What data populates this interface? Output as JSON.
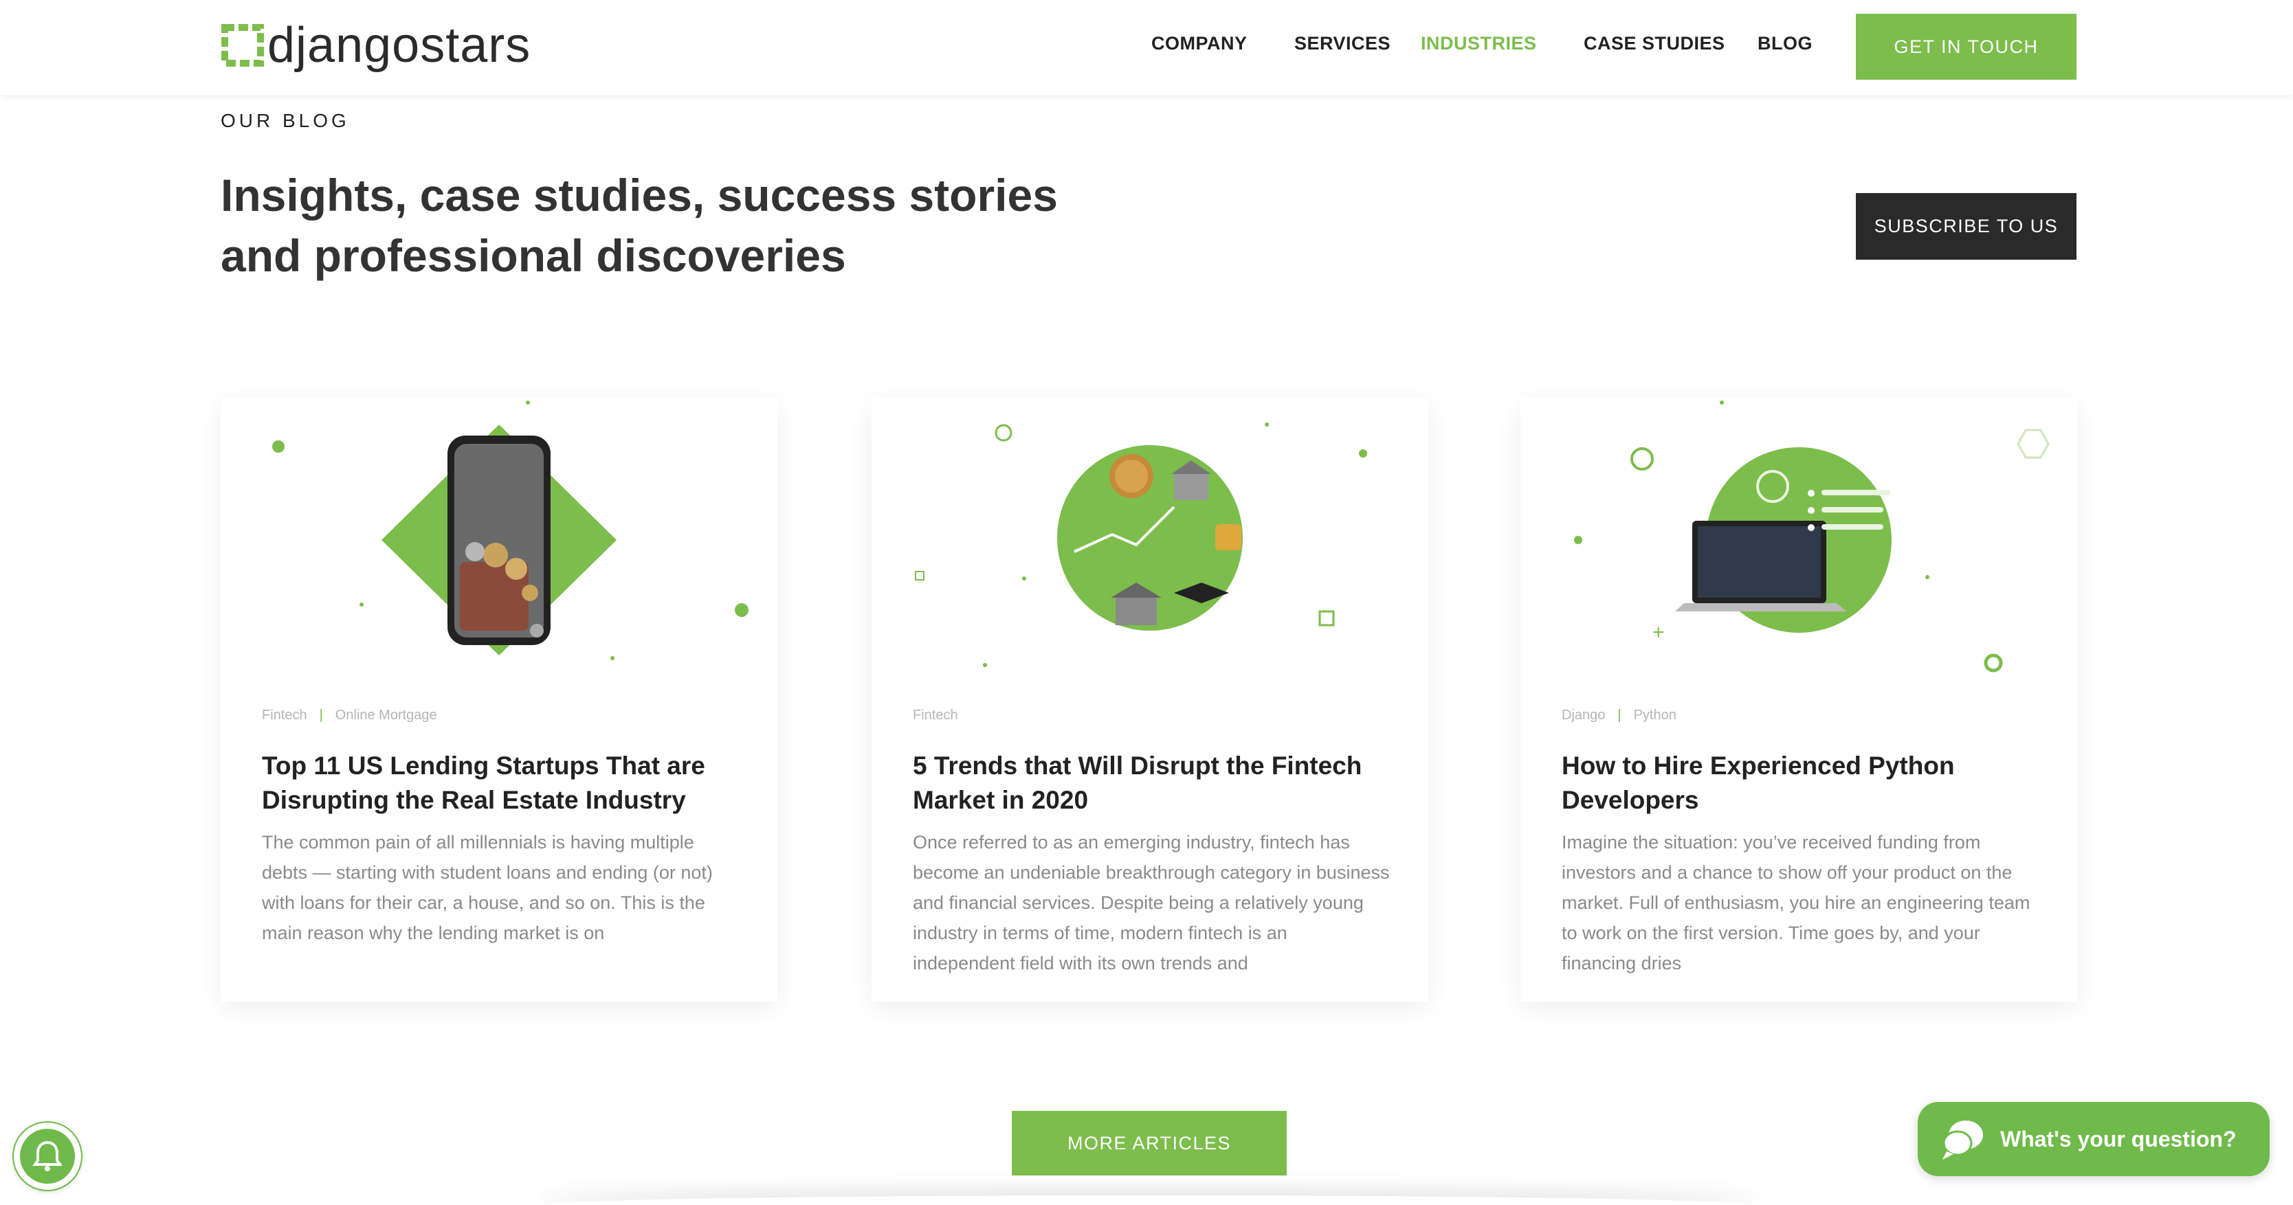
{
  "brand": {
    "name": "djangostars",
    "accent": "#7dbd4c",
    "dark": "#2a2a2a"
  },
  "nav": {
    "items": [
      {
        "label": "COMPANY",
        "active": false
      },
      {
        "label": "SERVICES",
        "active": false
      },
      {
        "label": "INDUSTRIES",
        "active": true
      },
      {
        "label": "CASE STUDIES",
        "active": false
      },
      {
        "label": "BLOG",
        "active": false
      }
    ],
    "cta": "GET IN TOUCH"
  },
  "hero": {
    "kicker": "OUR BLOG",
    "title": "Insights, case studies, success stories and professional discoveries",
    "subscribe": "SUBSCRIBE TO US"
  },
  "articles": [
    {
      "tags": [
        "Fintech",
        "Online Mortgage"
      ],
      "title": "Top 11 US Lending Startups That are Disrupting the Real Estate Industry",
      "excerpt": "The common pain of all millennials is having multiple debts — starting with student loans and ending (or not) with loans for their car, a house, and so on. This is the main reason why the lending market is on",
      "illustration": "phone-wallet-coins"
    },
    {
      "tags": [
        "Fintech"
      ],
      "title": "5 Trends that Will Disrupt the Fintech Market in 2020",
      "excerpt": "Once referred to as an emerging industry, fintech has become an undeniable breakthrough category in business and financial services. Despite being a relatively young industry in terms of time, modern fintech is an independent field with its own trends and",
      "illustration": "fintech-globe-icons"
    },
    {
      "tags": [
        "Django",
        "Python"
      ],
      "title": "How to Hire Experienced Python Developers",
      "excerpt": "Imagine the situation: you’ve received funding from investors and a chance to show off your product on the market. Full of enthusiasm, you hire an engineering team to work on the first version. Time goes by, and your financing dries",
      "illustration": "laptop-python"
    }
  ],
  "more_articles": "MORE ARTICLES",
  "chat": {
    "label": "What's your question?",
    "icon": "chat-bubble-icon"
  },
  "notifications": {
    "icon": "bell-icon"
  }
}
